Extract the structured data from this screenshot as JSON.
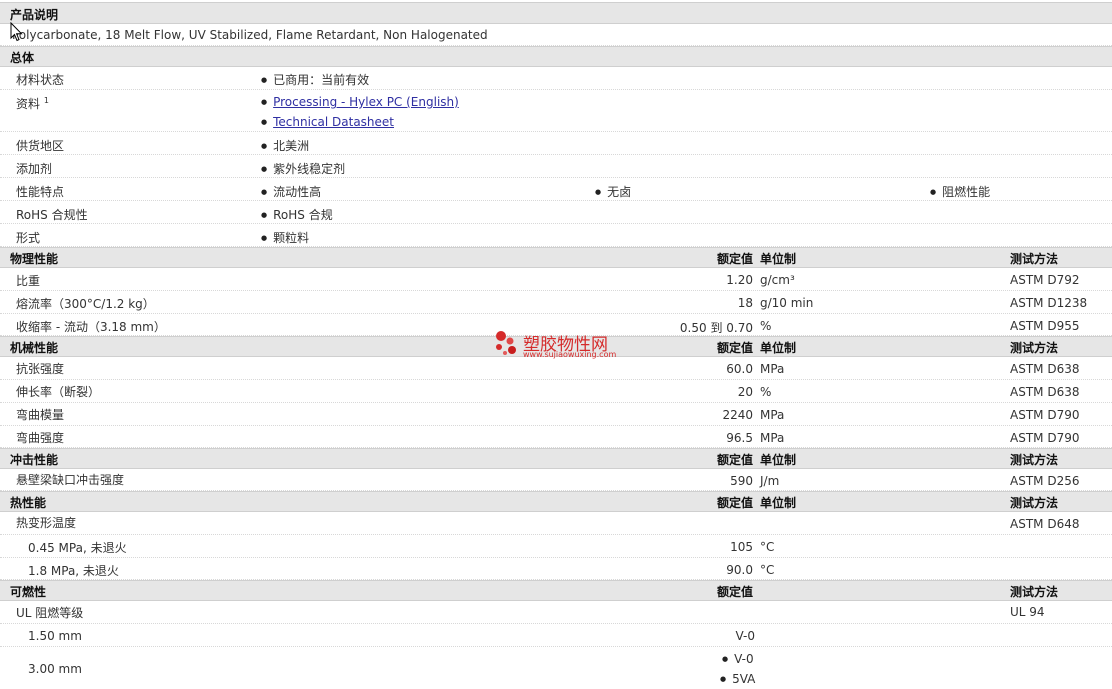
{
  "product": {
    "header": "产品说明",
    "description": "Polycarbonate, 18 Melt Flow, UV Stabilized, Flame Retardant, Non Halogenated"
  },
  "general": {
    "header": "总体",
    "material_status_label": "材料状态",
    "material_status_value": "已商用：当前有效",
    "documents_label": "资料",
    "documents_sup": "1",
    "doc_link_1": "Processing - Hylex PC (English)",
    "doc_link_2": "Technical Datasheet",
    "availability_label": "供货地区",
    "availability_value": "北美洲",
    "additive_label": "添加剂",
    "additive_value": "紫外线稳定剂",
    "features_label": "性能特点",
    "features": [
      "流动性高",
      "无卤",
      "阻燃性能"
    ],
    "rohs_label": "RoHS 合规性",
    "rohs_value": "RoHS 合规",
    "form_label": "形式",
    "form_value": "颗粒料"
  },
  "columns": {
    "nominal": "额定值",
    "unit": "单位制",
    "method": "测试方法"
  },
  "physical": {
    "header": "物理性能",
    "rows": [
      {
        "name": "比重",
        "value": "1.20",
        "unit": "g/cm³",
        "method": "ASTM D792"
      },
      {
        "name": "熔流率（300°C/1.2 kg）",
        "value": "18",
        "unit": "g/10 min",
        "method": "ASTM D1238"
      },
      {
        "name": "收缩率 - 流动（3.18 mm）",
        "value": "0.50 到 0.70",
        "unit": "%",
        "method": "ASTM D955"
      }
    ]
  },
  "mechanical": {
    "header": "机械性能",
    "rows": [
      {
        "name": "抗张强度",
        "value": "60.0",
        "unit": "MPa",
        "method": "ASTM D638"
      },
      {
        "name": "伸长率（断裂）",
        "value": "20",
        "unit": "%",
        "method": "ASTM D638"
      },
      {
        "name": "弯曲模量",
        "value": "2240",
        "unit": "MPa",
        "method": "ASTM D790"
      },
      {
        "name": "弯曲强度",
        "value": "96.5",
        "unit": "MPa",
        "method": "ASTM D790"
      }
    ]
  },
  "impact": {
    "header": "冲击性能",
    "rows": [
      {
        "name": "悬壁梁缺口冲击强度",
        "value": "590",
        "unit": "J/m",
        "method": "ASTM D256"
      }
    ]
  },
  "thermal": {
    "header": "热性能",
    "hdt_label": "热变形温度",
    "hdt_method": "ASTM D648",
    "rows": [
      {
        "name": "0.45 MPa, 未退火",
        "value": "105",
        "unit": "°C"
      },
      {
        "name": "1.8 MPa, 未退火",
        "value": "90.0",
        "unit": "°C"
      }
    ]
  },
  "flammability": {
    "header": "可燃性",
    "ul_label": "UL 阻燃等级",
    "ul_method": "UL 94",
    "rows": [
      {
        "name": "1.50 mm",
        "value": "V-0"
      },
      {
        "name": "3.00 mm",
        "values": [
          "V-0",
          "5VA"
        ]
      }
    ]
  },
  "watermark": {
    "text": "塑胶物性网",
    "url": "www.sujiaowuxing.com",
    "color": "#d52b2b"
  }
}
